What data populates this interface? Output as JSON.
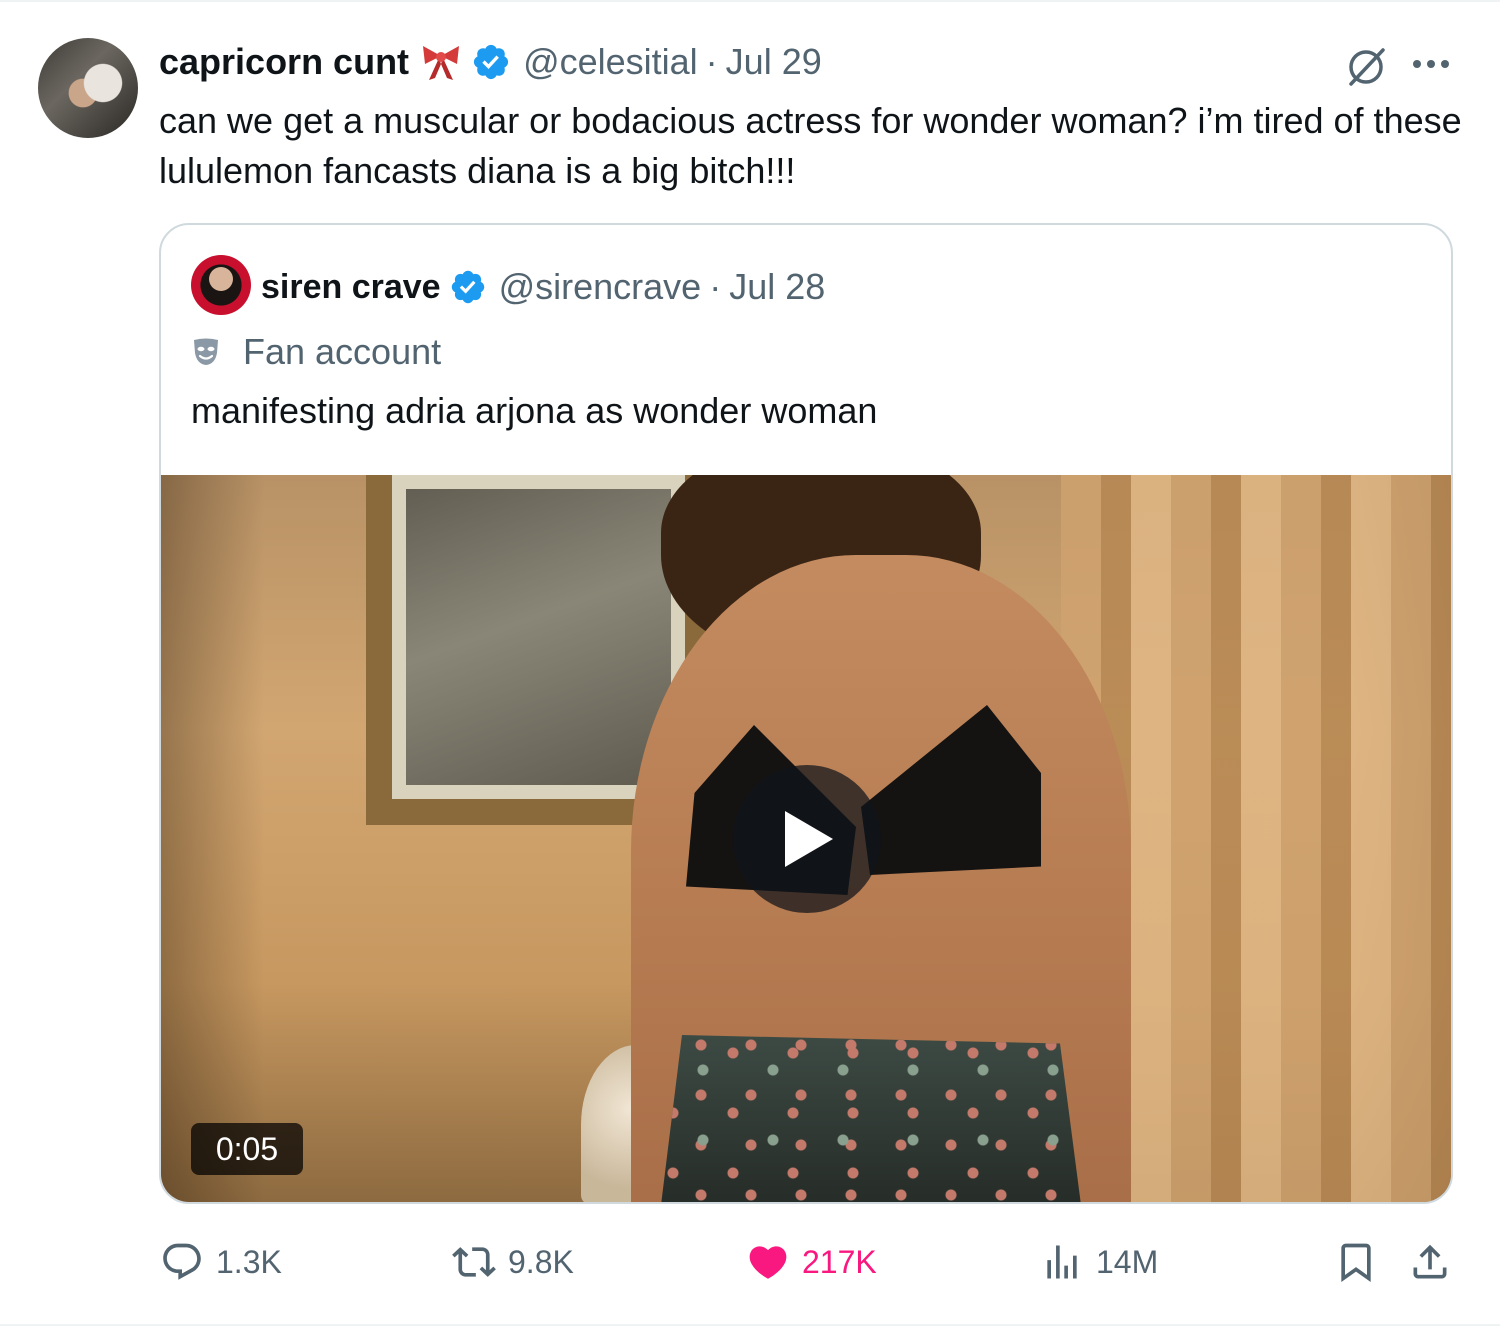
{
  "tweet": {
    "display_name": "capricorn cunt",
    "handle": "@celesitial",
    "separator": "·",
    "date": "Jul 29",
    "text": "can we get a muscular or bodacious actress for wonder woman? i’m tired of these lululemon fancasts diana is a big bitch!!!",
    "icons": {
      "name_emoji": "ribbon-bow-icon",
      "verified": "verified-badge-icon",
      "grok": "grok-icon",
      "more": "more-dots-icon"
    }
  },
  "quote": {
    "display_name": "siren crave",
    "handle": "@sirencrave",
    "separator": "·",
    "date": "Jul 28",
    "label": "Fan account",
    "text": "manifesting adria arjona as wonder woman",
    "video": {
      "duration": "0:05"
    }
  },
  "actions": {
    "replies": "1.3K",
    "retweets": "9.8K",
    "likes": "217K",
    "views": "14M"
  },
  "colors": {
    "verified": "#1d9bf0",
    "like": "#f91880",
    "secondary_text": "#536471",
    "border": "#cfd9de"
  }
}
